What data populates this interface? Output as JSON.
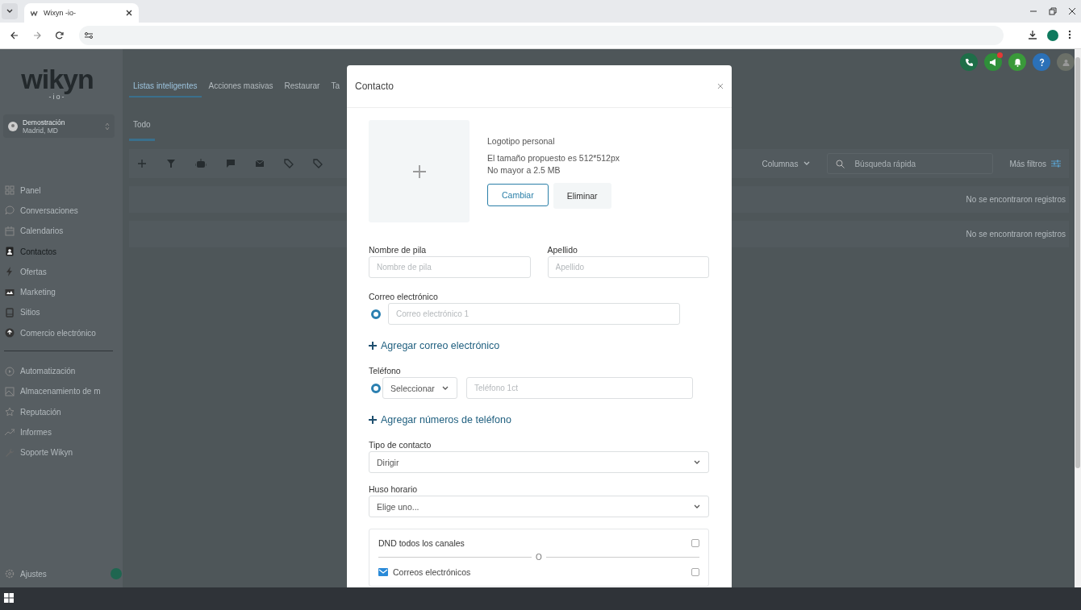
{
  "browser": {
    "tab_title": "Wixyn -io-"
  },
  "app": {
    "logo": {
      "name": "wikyn",
      "sub": "-io-"
    },
    "account": {
      "name": "Demostración",
      "location": "Madrid, MD"
    },
    "sidebar": {
      "groups": [
        [
          {
            "label": "Panel",
            "kind": "grid",
            "selected": false
          },
          {
            "label": "Conversaciones",
            "kind": "chat",
            "selected": false
          },
          {
            "label": "Calendarios",
            "kind": "calendar",
            "selected": false
          },
          {
            "label": "Contactos",
            "kind": "contact",
            "selected": true
          },
          {
            "label": "Ofertas",
            "kind": "bolt",
            "selected": false
          },
          {
            "label": "Marketing",
            "kind": "screen",
            "selected": false
          },
          {
            "label": "Sitios",
            "kind": "book",
            "selected": false
          },
          {
            "label": "Comercio electrónico",
            "kind": "circle",
            "selected": false
          }
        ],
        [
          {
            "label": "Automatización",
            "kind": "play",
            "selected": false
          },
          {
            "label": "Almacenamiento de m",
            "kind": "image",
            "selected": false
          },
          {
            "label": "Reputación",
            "kind": "star",
            "selected": false
          },
          {
            "label": "Informes",
            "kind": "trend",
            "selected": false
          },
          {
            "label": "Soporte Wikyn",
            "kind": "wrench",
            "selected": false
          }
        ]
      ],
      "footer": {
        "label": "Ajustes"
      }
    },
    "top_tabs": [
      {
        "label": "Listas inteligentes",
        "selected": true
      },
      {
        "label": "Acciones masivas",
        "selected": false
      },
      {
        "label": "Restaurar",
        "selected": false
      },
      {
        "label": "Ta",
        "selected": false
      }
    ],
    "sub_tabs": [
      {
        "label": "Todo",
        "selected": true
      }
    ],
    "header_icons": [
      {
        "kind": "phone",
        "color": "#1e6e48",
        "badge": false
      },
      {
        "kind": "megaphone",
        "color": "#2f8f3a",
        "badge": true
      },
      {
        "kind": "bell",
        "color": "#3a9a3a",
        "badge": false
      },
      {
        "kind": "help",
        "color": "#2b71b8",
        "badge": false
      },
      {
        "kind": "avatar",
        "color": "#6b7068",
        "badge": false
      }
    ],
    "toolbar": {
      "columns_label": "Columnas",
      "search_placeholder": "Búsqueda rápida",
      "filters_label": "Más filtros"
    },
    "empty_messages": [
      "No se encontraron registros",
      "No se encontraron registros"
    ]
  },
  "modal": {
    "title": "Contacto",
    "logo": {
      "title": "Logotipo personal",
      "hint_lines": [
        "El tamaño propuesto es 512*512px",
        "No mayor a 2.5 MB"
      ],
      "buttons": [
        {
          "label": "Cambiar",
          "kind": "outline"
        },
        {
          "label": "Eliminar",
          "kind": "plain"
        }
      ]
    },
    "name_fields": [
      {
        "label": "Nombre de pila",
        "placeholder": "Nombre de pila"
      },
      {
        "label": "Apellido",
        "placeholder": "Apellido"
      }
    ],
    "email": {
      "label": "Correo electrónico",
      "entries": [
        {
          "placeholder": "Correo electrónico 1",
          "selected": true
        }
      ],
      "add_link": "Agregar correo electrónico"
    },
    "phone": {
      "label": "Teléfono",
      "entries": [
        {
          "country": "Seleccionar",
          "placeholder": "Teléfono 1ct",
          "selected": true
        }
      ],
      "add_link": "Agregar números de teléfono"
    },
    "contact_type": {
      "label": "Tipo de contacto",
      "value": "Dirigir"
    },
    "timezone": {
      "label": "Huso horario",
      "value": "Elige uno..."
    },
    "dnd": {
      "all": {
        "label": "DND todos los canales",
        "checked": false
      },
      "separator": "O",
      "channels": [
        {
          "label": "Correos electrónicos",
          "checked": false
        }
      ]
    }
  }
}
